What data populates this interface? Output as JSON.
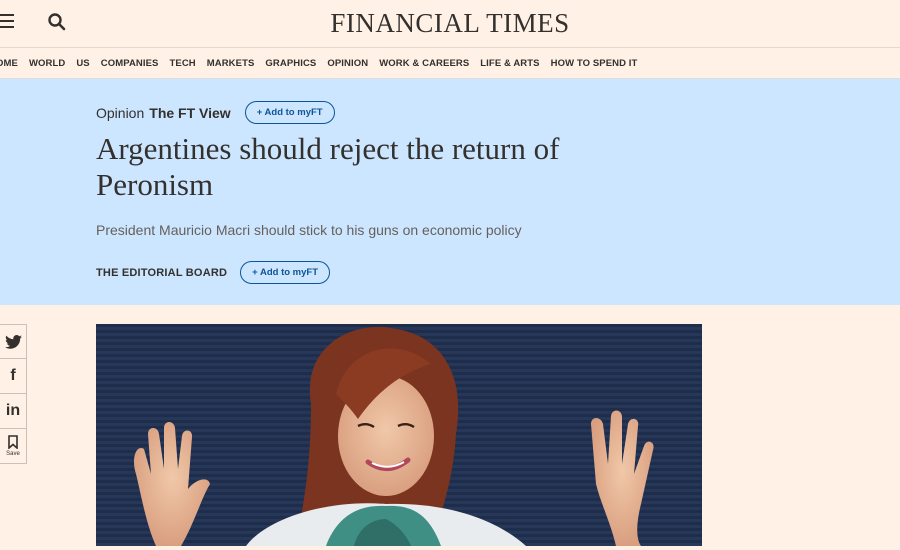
{
  "header": {
    "logo": "FINANCIAL TIMES",
    "menu_icon": "hamburger-menu-icon",
    "search_icon": "search-icon"
  },
  "nav": {
    "items": [
      "OME",
      "WORLD",
      "US",
      "COMPANIES",
      "TECH",
      "MARKETS",
      "GRAPHICS",
      "OPINION",
      "WORK & CAREERS",
      "LIFE & ARTS",
      "HOW TO SPEND IT"
    ]
  },
  "article": {
    "section": "Opinion",
    "series": "The FT View",
    "add_myft_small": "+ Add to myFT",
    "headline": "Argentines should reject the return of Peronism",
    "standfirst": "President Mauricio Macri should stick to his guns on economic policy",
    "byline": "THE EDITORIAL BOARD",
    "add_myft": "+ Add to myFT"
  },
  "share": {
    "twitter_glyph": "t",
    "facebook_glyph": "f",
    "linkedin_glyph": "in",
    "save_label": "Save"
  },
  "colors": {
    "background": "#fff1e5",
    "hero": "#cce6ff",
    "accent": "#0f5499",
    "text": "#33302e"
  }
}
